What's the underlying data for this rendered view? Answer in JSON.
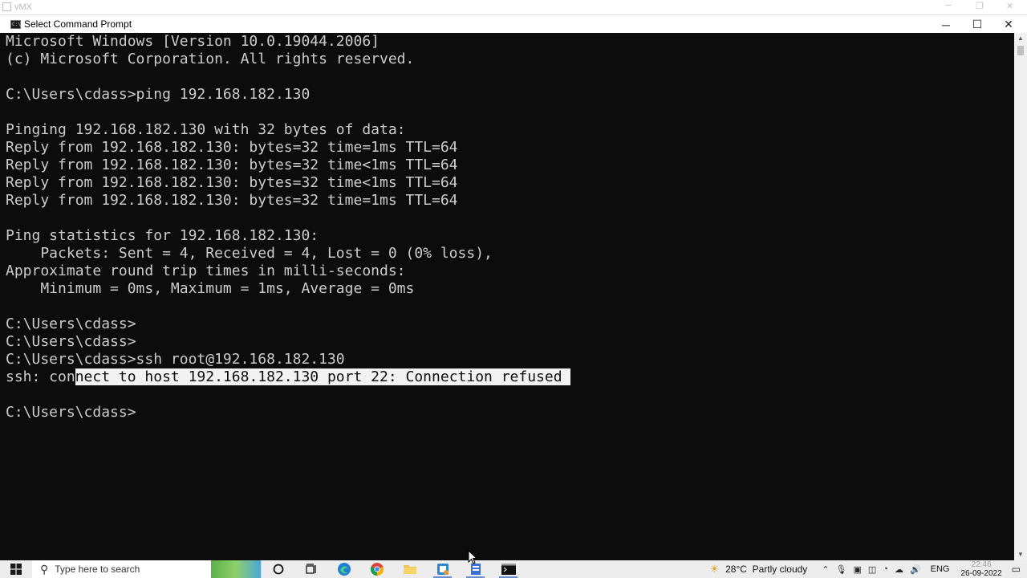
{
  "background_window": {
    "title": "vMX",
    "minimize": "─",
    "restore": "❐",
    "close": "✕"
  },
  "window": {
    "icon_text": "C:\\",
    "title": "Select Command Prompt",
    "minimize": "─",
    "maximize": "☐",
    "close": "✕"
  },
  "console": {
    "lines": [
      "Microsoft Windows [Version 10.0.19044.2006]",
      "(c) Microsoft Corporation. All rights reserved.",
      "",
      "C:\\Users\\cdass>ping 192.168.182.130",
      "",
      "Pinging 192.168.182.130 with 32 bytes of data:",
      "Reply from 192.168.182.130: bytes=32 time=1ms TTL=64",
      "Reply from 192.168.182.130: bytes=32 time<1ms TTL=64",
      "Reply from 192.168.182.130: bytes=32 time<1ms TTL=64",
      "Reply from 192.168.182.130: bytes=32 time=1ms TTL=64",
      "",
      "Ping statistics for 192.168.182.130:",
      "    Packets: Sent = 4, Received = 4, Lost = 0 (0% loss),",
      "Approximate round trip times in milli-seconds:",
      "    Minimum = 0ms, Maximum = 1ms, Average = 0ms",
      "",
      "C:\\Users\\cdass>",
      "C:\\Users\\cdass>",
      "C:\\Users\\cdass>ssh root@192.168.182.130"
    ],
    "error_unselected": "ssh: con",
    "error_selected": "nect to host 192.168.182.130 port 22: Connection refused ",
    "blank": "",
    "prompt": "C:\\Users\\cdass>"
  },
  "scrollbar": {
    "up": "▲",
    "down": "▼"
  },
  "taskbar": {
    "start_icon": "windows-logo",
    "search_placeholder": "Type here to search",
    "pinned": [
      "cortana",
      "task-view",
      "edge",
      "chrome",
      "file-explorer",
      "snipping-tool",
      "terminal-settings",
      "command-prompt"
    ],
    "weather_temp": "28°C",
    "weather_desc": "Partly cloudy",
    "language": "ENG",
    "time": "22:46",
    "date": "26-09-2022"
  }
}
